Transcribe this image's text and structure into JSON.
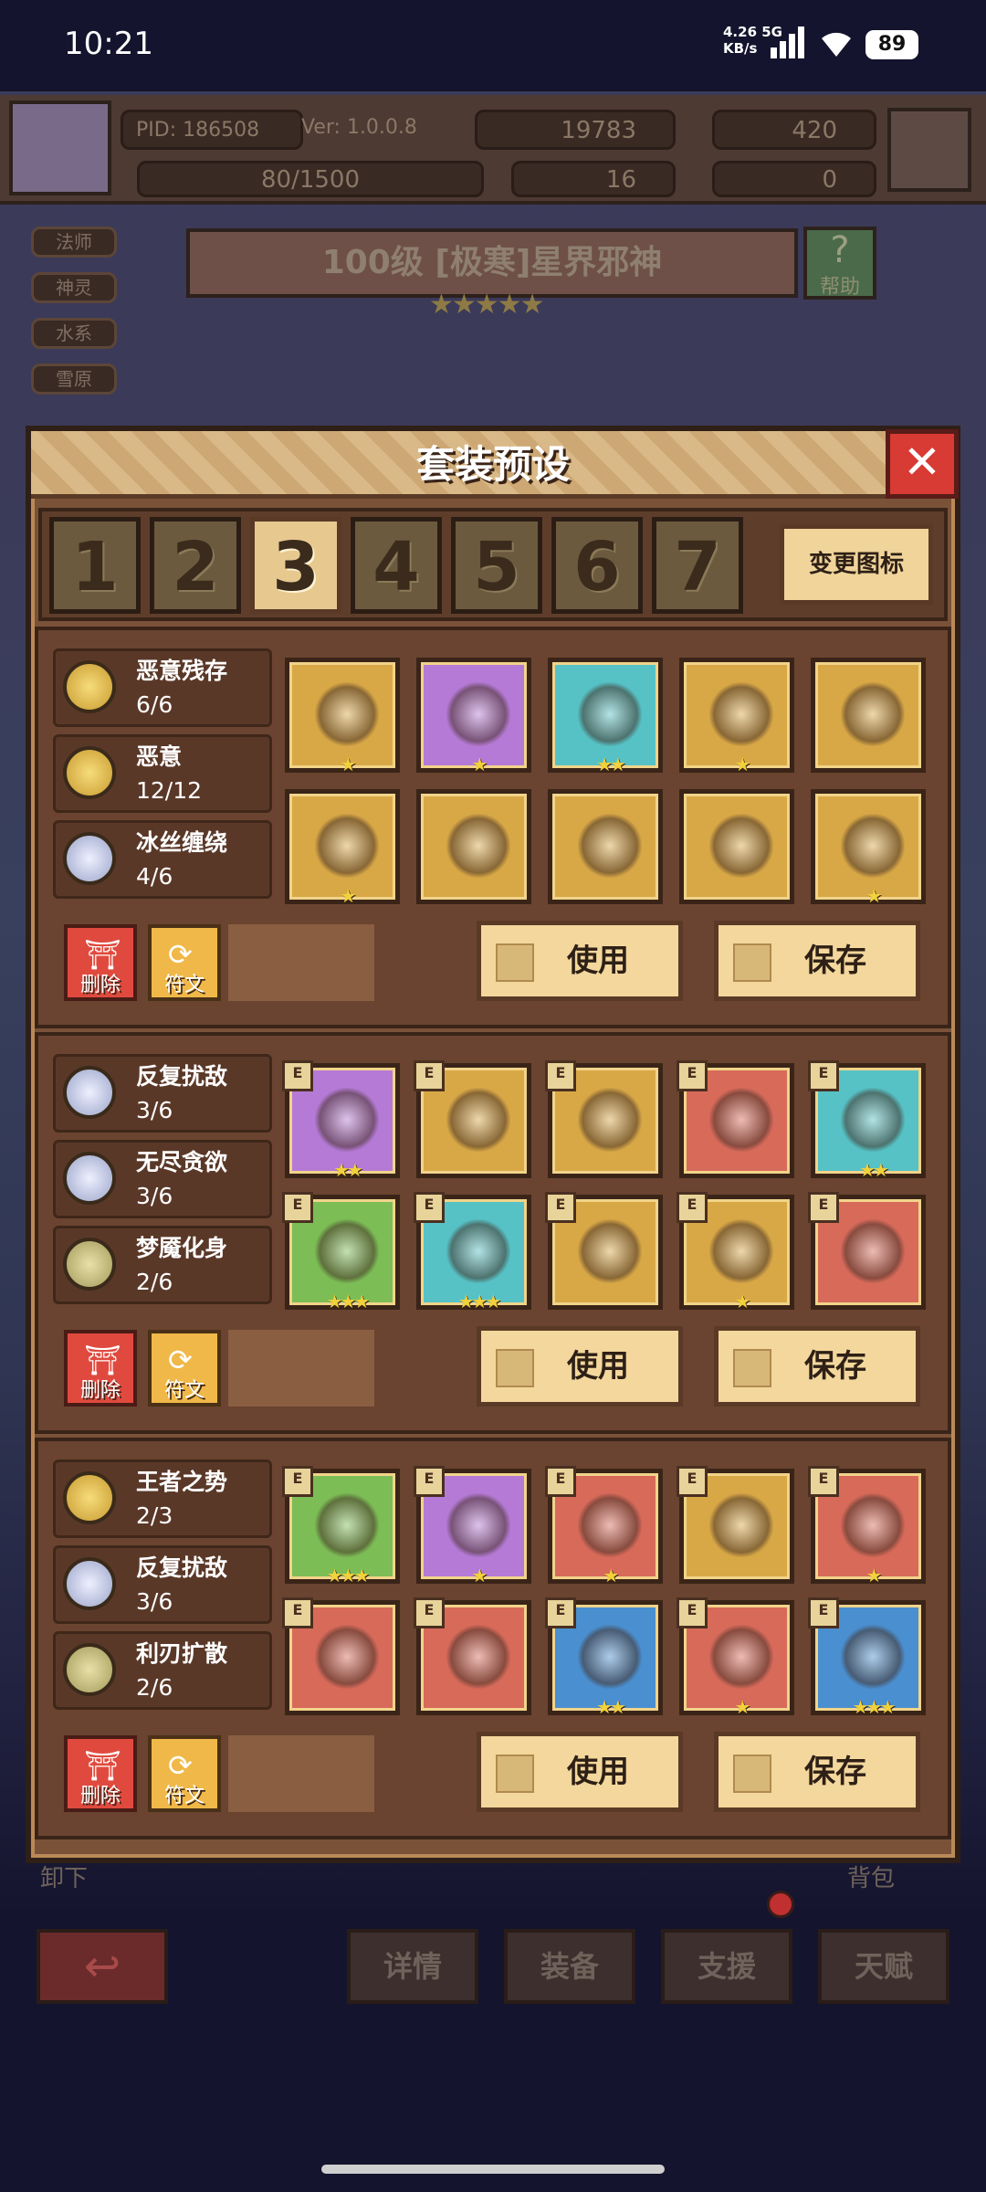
{
  "status_bar": {
    "time": "10:21",
    "net_speed": "4.26",
    "net_unit": "KB/s",
    "net_type": "5G",
    "battery": "89"
  },
  "header": {
    "pid": "PID: 186508",
    "version": "Ver: 1.0.0.8",
    "gold": "19783",
    "gems": "420",
    "exp": "80/1500",
    "clovers": "16",
    "keys": "0"
  },
  "tags": [
    "法师",
    "神灵",
    "水系",
    "雪原"
  ],
  "boss": {
    "title": "100级 [极寒]星界邪神",
    "stars": 5
  },
  "help_label": "帮助",
  "modal": {
    "title": "套装预设",
    "tabs": [
      "1",
      "2",
      "3",
      "4",
      "5",
      "6",
      "7"
    ],
    "active_tab": 2,
    "change_icon_label": "变更图标",
    "delete_label": "删除",
    "rune_label": "符文",
    "use_label": "使用",
    "save_label": "保存",
    "presets": [
      {
        "sets": [
          {
            "name": "恶意残存",
            "count": "6/6",
            "medal": "gold"
          },
          {
            "name": "恶意",
            "count": "12/12",
            "medal": "gold"
          },
          {
            "name": "冰丝缠绕",
            "count": "4/6",
            "medal": "silver"
          }
        ],
        "items": [
          {
            "icon": "scepter-icon",
            "bg": "gold",
            "stars": 1,
            "e": false
          },
          {
            "icon": "crystal-chalice-icon",
            "bg": "purple",
            "stars": 1,
            "e": false
          },
          {
            "icon": "necklace-icon",
            "bg": "teal",
            "stars": 2,
            "e": false
          },
          {
            "icon": "rock-orb-icon",
            "bg": "gold",
            "stars": 1,
            "e": false
          },
          {
            "icon": "ice-crown-icon",
            "bg": "gold",
            "stars": 0,
            "e": false
          },
          {
            "icon": "green-armor-icon",
            "bg": "gold",
            "stars": 1,
            "e": false
          },
          {
            "icon": "ice-armor-icon",
            "bg": "gold",
            "stars": 0,
            "e": false
          },
          {
            "icon": "ice-boots-icon",
            "bg": "gold",
            "stars": 0,
            "e": false
          },
          {
            "icon": "green-mask-icon",
            "bg": "gold",
            "stars": 0,
            "e": false
          },
          {
            "icon": "dark-boots-icon",
            "bg": "gold",
            "stars": 1,
            "e": false
          }
        ]
      },
      {
        "sets": [
          {
            "name": "反复扰敌",
            "count": "3/6",
            "medal": "silver"
          },
          {
            "name": "无尽贪欲",
            "count": "3/6",
            "medal": "silver"
          },
          {
            "name": "梦魇化身",
            "count": "2/6",
            "medal": "bronze"
          }
        ],
        "items": [
          {
            "icon": "ice-sword-icon",
            "bg": "purple",
            "stars": 2,
            "e": true
          },
          {
            "icon": "shield-icon",
            "bg": "gold",
            "stars": 0,
            "e": true
          },
          {
            "icon": "ruby-necklace-icon",
            "bg": "gold",
            "stars": 0,
            "e": true
          },
          {
            "icon": "pink-orb-icon",
            "bg": "red",
            "stars": 0,
            "e": true
          },
          {
            "icon": "ring-icon",
            "bg": "teal",
            "stars": 2,
            "e": true
          },
          {
            "icon": "cape-armor-icon",
            "bg": "green",
            "stars": 3,
            "e": true
          },
          {
            "icon": "striped-armor-icon",
            "bg": "teal",
            "stars": 3,
            "e": true
          },
          {
            "icon": "demon-helm-icon",
            "bg": "gold",
            "stars": 0,
            "e": true
          },
          {
            "icon": "dark-crown-icon",
            "bg": "gold",
            "stars": 1,
            "e": true
          },
          {
            "icon": "red-boots-icon",
            "bg": "red",
            "stars": 0,
            "e": true
          }
        ]
      },
      {
        "sets": [
          {
            "name": "王者之势",
            "count": "2/3",
            "medal": "gold"
          },
          {
            "name": "反复扰敌",
            "count": "3/6",
            "medal": "silver"
          },
          {
            "name": "利刃扩散",
            "count": "2/6",
            "medal": "bronze"
          }
        ],
        "items": [
          {
            "icon": "spear-icon",
            "bg": "green",
            "stars": 3,
            "e": true
          },
          {
            "icon": "dagger-icon",
            "bg": "purple",
            "stars": 1,
            "e": true
          },
          {
            "icon": "heart-necklace-icon",
            "bg": "red",
            "stars": 1,
            "e": true
          },
          {
            "icon": "winged-shield-icon",
            "bg": "gold",
            "stars": 0,
            "e": true
          },
          {
            "icon": "heart-ring-icon",
            "bg": "red",
            "stars": 1,
            "e": true
          },
          {
            "icon": "straw-hat-icon",
            "bg": "red",
            "stars": 0,
            "e": true
          },
          {
            "icon": "demon-armor-icon",
            "bg": "red",
            "stars": 0,
            "e": true
          },
          {
            "icon": "gauntlet-icon",
            "bg": "blue",
            "stars": 2,
            "e": true
          },
          {
            "icon": "gem-bracelet-icon",
            "bg": "red",
            "stars": 1,
            "e": true
          },
          {
            "icon": "leather-boots-icon",
            "bg": "blue",
            "stars": 3,
            "e": true
          }
        ]
      }
    ]
  },
  "bottom": {
    "unload_label": "卸下",
    "bag_label": "背包",
    "nav": [
      "详情",
      "装备",
      "支援",
      "天赋"
    ]
  }
}
